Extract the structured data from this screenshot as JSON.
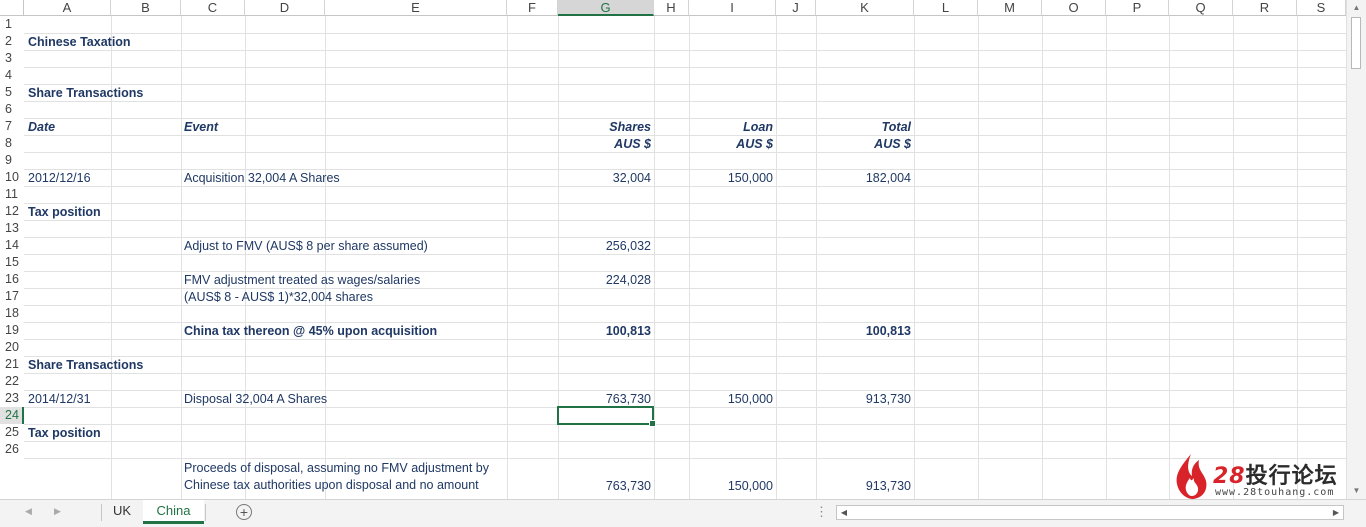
{
  "columns": [
    "A",
    "B",
    "C",
    "D",
    "E",
    "F",
    "G",
    "H",
    "I",
    "J",
    "K",
    "L",
    "M",
    "O",
    "P",
    "Q",
    "R",
    "S"
  ],
  "selected_column": "G",
  "rows": [
    "1",
    "2",
    "3",
    "4",
    "5",
    "6",
    "7",
    "8",
    "9",
    "10",
    "11",
    "12",
    "13",
    "14",
    "15",
    "16",
    "17",
    "18",
    "19",
    "20",
    "21",
    "22",
    "23",
    "24",
    "25",
    "26"
  ],
  "selected_row": "24",
  "sheet": {
    "r2_title": "Chinese Taxation",
    "r5_section": "Share Transactions",
    "r7_date": "Date",
    "r7_event": "Event",
    "r7_shares": "Shares",
    "r7_loan": "Loan",
    "r7_total": "Total",
    "r8_shares_unit": "AUS $",
    "r8_loan_unit": "AUS $",
    "r8_total_unit": "AUS $",
    "r10_date": "2012/12/16",
    "r10_event": "Acquisition 32,004 A Shares",
    "r10_shares": "32,004",
    "r10_loan": "150,000",
    "r10_total": "182,004",
    "r12_section": "Tax position",
    "r14_event": "Adjust to FMV (AUS$ 8 per share assumed)",
    "r14_shares": "256,032",
    "r16_event": "FMV adjustment treated as wages/salaries",
    "r16_shares": "224,028",
    "r17_event": "(AUS$ 8 - AUS$ 1)*32,004 shares",
    "r19_event": "China tax thereon @ 45% upon acquisition",
    "r19_shares": "100,813",
    "r19_total": "100,813",
    "r21_section": "Share Transactions",
    "r23_date": "2014/12/31",
    "r23_event": "Disposal 32,004 A Shares",
    "r23_shares": "763,730",
    "r23_loan": "150,000",
    "r23_total": "913,730",
    "r25_section": "Tax position",
    "r27_event": "Proceeds of disposal, assuming no FMV adjustment by Chinese tax authorities upon disposal and no amount",
    "r27_shares": "763,730",
    "r27_loan": "150,000",
    "r27_total": "913,730"
  },
  "tabs": {
    "uk": "UK",
    "china": "China",
    "active": "China"
  },
  "watermark": {
    "brand_number": "28",
    "brand_name": "投行论坛",
    "url": "www.28touhang.com"
  },
  "colors": {
    "accent": "#217346",
    "cell_text": "#1f3864",
    "logo_red": "#d9232a"
  }
}
